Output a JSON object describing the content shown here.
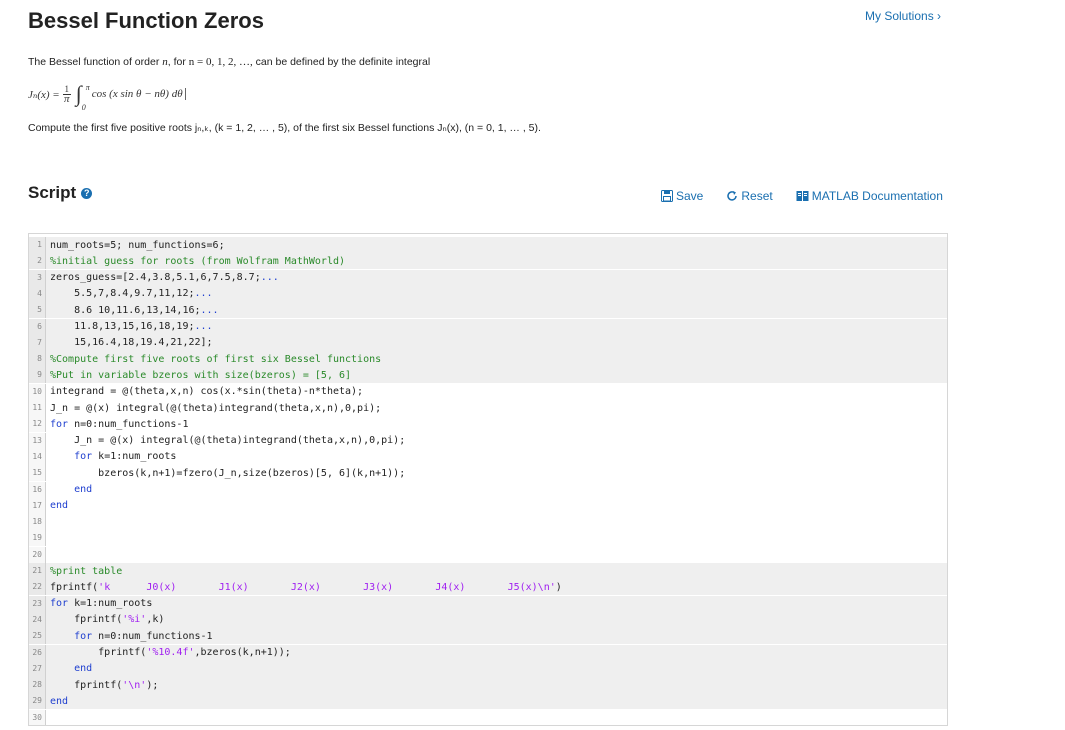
{
  "page": {
    "title": "Bessel Function Zeros",
    "my_solutions": "My Solutions ›"
  },
  "problem": {
    "intro_a": "The Bessel function of order ",
    "intro_n": "n",
    "intro_b": ", for ",
    "intro_range": "n = 0, 1, 2, …,",
    "intro_c": " can be defined by the definite integral",
    "formula_lhs": "Jₙ(x) =",
    "formula_frac_num": "1",
    "formula_frac_den": "π",
    "formula_int_upper": "π",
    "formula_int_lower": "0",
    "formula_integrand": "cos (x sin θ − nθ) dθ",
    "task": "Compute the first five positive roots jₙ,ₖ, (k = 1, 2, … , 5), of the first six Bessel functions Jₙ(x), (n = 0, 1, … , 5)."
  },
  "script": {
    "heading": "Script",
    "help_icon": "?",
    "save_label": "Save",
    "reset_label": "Reset",
    "docs_label": "MATLAB Documentation"
  },
  "code_lines": [
    {
      "n": "1",
      "shaded": true,
      "parts": [
        {
          "t": "num_roots=5; num_functions=6;"
        }
      ]
    },
    {
      "n": "2",
      "shaded": true,
      "parts": [
        {
          "t": "%initial guess for roots (from Wolfram MathWorld)",
          "c": "cm"
        }
      ]
    },
    {
      "n": "3",
      "shaded": true,
      "parts": [
        {
          "t": "zeros_guess=[2.4,3.8,5.1,6,7.5,8.7;"
        },
        {
          "t": "...",
          "c": "kw"
        }
      ]
    },
    {
      "n": "4",
      "shaded": true,
      "parts": [
        {
          "t": "    5.5,7,8.4,9.7,11,12;"
        },
        {
          "t": "...",
          "c": "kw"
        }
      ]
    },
    {
      "n": "5",
      "shaded": true,
      "parts": [
        {
          "t": "    8.6 10,11.6,13,14,16;"
        },
        {
          "t": "...",
          "c": "kw"
        }
      ]
    },
    {
      "n": "6",
      "shaded": true,
      "parts": [
        {
          "t": "    11.8,13,15,16,18,19;"
        },
        {
          "t": "...",
          "c": "kw"
        }
      ]
    },
    {
      "n": "7",
      "shaded": true,
      "parts": [
        {
          "t": "    15,16.4,18,19.4,21,22];"
        }
      ]
    },
    {
      "n": "8",
      "shaded": true,
      "parts": [
        {
          "t": "%Compute first five roots of first six Bessel functions",
          "c": "cm"
        }
      ]
    },
    {
      "n": "9",
      "shaded": true,
      "parts": [
        {
          "t": "%Put in variable bzeros with size(bzeros) = [5, 6]",
          "c": "cm"
        }
      ]
    },
    {
      "n": "10",
      "shaded": false,
      "parts": [
        {
          "t": "integrand = @(theta,x,n) cos(x.*sin(theta)-n*theta);"
        }
      ]
    },
    {
      "n": "11",
      "shaded": false,
      "parts": [
        {
          "t": "J_n = @(x) integral(@(theta)integrand(theta,x,n),0,pi);"
        }
      ]
    },
    {
      "n": "12",
      "shaded": false,
      "parts": [
        {
          "t": "for",
          "c": "kw"
        },
        {
          "t": " n=0:num_functions-1"
        }
      ]
    },
    {
      "n": "13",
      "shaded": false,
      "parts": [
        {
          "t": "    J_n = @(x) integral(@(theta)integrand(theta,x,n),0,pi);"
        }
      ]
    },
    {
      "n": "14",
      "shaded": false,
      "parts": [
        {
          "t": "    "
        },
        {
          "t": "for",
          "c": "kw"
        },
        {
          "t": " k=1:num_roots"
        }
      ]
    },
    {
      "n": "15",
      "shaded": false,
      "parts": [
        {
          "t": "        bzeros(k,n+1)=fzero(J_n,size(bzeros)[5, 6](k,n+1));"
        }
      ]
    },
    {
      "n": "16",
      "shaded": false,
      "parts": [
        {
          "t": "    "
        },
        {
          "t": "end",
          "c": "kw"
        }
      ]
    },
    {
      "n": "17",
      "shaded": false,
      "parts": [
        {
          "t": "end",
          "c": "kw"
        }
      ]
    },
    {
      "n": "18",
      "shaded": false,
      "parts": [
        {
          "t": ""
        }
      ]
    },
    {
      "n": "19",
      "shaded": false,
      "parts": [
        {
          "t": ""
        }
      ]
    },
    {
      "n": "20",
      "shaded": false,
      "parts": [
        {
          "t": ""
        }
      ]
    },
    {
      "n": "21",
      "shaded": true,
      "parts": [
        {
          "t": "%print table",
          "c": "cm"
        }
      ]
    },
    {
      "n": "22",
      "shaded": true,
      "parts": [
        {
          "t": "fprintf("
        },
        {
          "t": "'k      J0(x)       J1(x)       J2(x)       J3(x)       J4(x)       J5(x)\\n'",
          "c": "st"
        },
        {
          "t": ")"
        }
      ]
    },
    {
      "n": "23",
      "shaded": true,
      "parts": [
        {
          "t": "for",
          "c": "kw"
        },
        {
          "t": " k=1:num_roots"
        }
      ]
    },
    {
      "n": "24",
      "shaded": true,
      "parts": [
        {
          "t": "    fprintf("
        },
        {
          "t": "'%i'",
          "c": "st"
        },
        {
          "t": ",k)"
        }
      ]
    },
    {
      "n": "25",
      "shaded": true,
      "parts": [
        {
          "t": "    "
        },
        {
          "t": "for",
          "c": "kw"
        },
        {
          "t": " n=0:num_functions-1"
        }
      ]
    },
    {
      "n": "26",
      "shaded": true,
      "parts": [
        {
          "t": "        fprintf("
        },
        {
          "t": "'%10.4f'",
          "c": "st"
        },
        {
          "t": ",bzeros(k,n+1));"
        }
      ]
    },
    {
      "n": "27",
      "shaded": true,
      "parts": [
        {
          "t": "    "
        },
        {
          "t": "end",
          "c": "kw"
        }
      ]
    },
    {
      "n": "28",
      "shaded": true,
      "parts": [
        {
          "t": "    fprintf("
        },
        {
          "t": "'\\n'",
          "c": "st"
        },
        {
          "t": ");"
        }
      ]
    },
    {
      "n": "29",
      "shaded": true,
      "parts": [
        {
          "t": "end",
          "c": "kw"
        }
      ]
    },
    {
      "n": "30",
      "shaded": false,
      "parts": [
        {
          "t": ""
        }
      ]
    }
  ]
}
